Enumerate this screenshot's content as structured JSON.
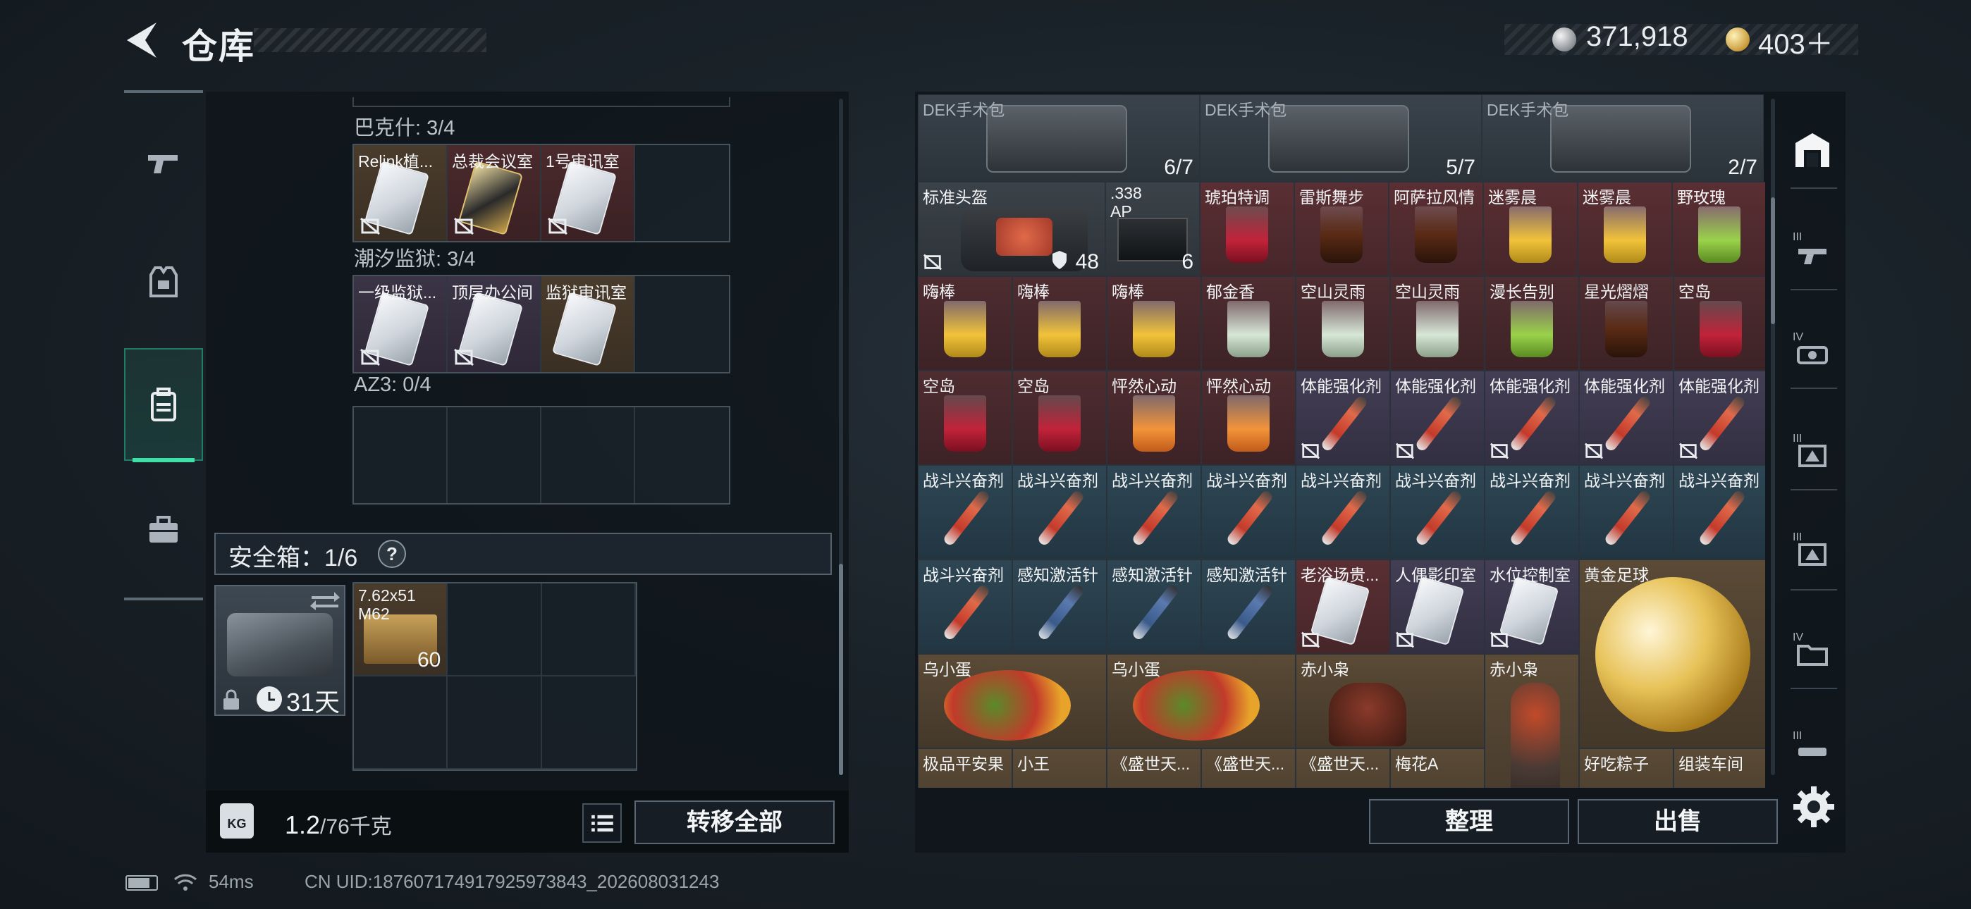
{
  "header": {
    "title": "仓库",
    "silver": "371,918",
    "gold": "403＋"
  },
  "left_groups": [
    {
      "label": "巴克什: 3/4",
      "slots": [
        "Relink植...",
        "总裁会议室",
        "1号审讯室",
        ""
      ]
    },
    {
      "label": "潮汐监狱: 3/4",
      "slots": [
        "一级监狱...",
        "顶层办公间",
        "监狱审讯室",
        ""
      ]
    },
    {
      "label": "AZ3: 0/4",
      "slots": [
        "",
        "",
        "",
        ""
      ]
    }
  ],
  "safe": {
    "label": "安全箱：1/6",
    "help": "?",
    "days": "31天",
    "ammo_name_1": "7.62x51",
    "ammo_name_2": "M62",
    "ammo_count": "60"
  },
  "weight": {
    "icon": "KG",
    "current": "1.2",
    "unit": "/76千克"
  },
  "buttons": {
    "transfer_all": "转移全部",
    "sort": "整理",
    "sell": "出售"
  },
  "inventory": {
    "medkits": [
      {
        "name": "DEK手术包",
        "count": "6/7"
      },
      {
        "name": "DEK手术包",
        "count": "5/7"
      },
      {
        "name": "DEK手术包",
        "count": "2/7"
      }
    ],
    "helmet": {
      "name": "标准头盔",
      "count": "48"
    },
    "ammo338": {
      "name1": ".338",
      "name2": "AP",
      "count": "6"
    },
    "row1_drinks": [
      "琥珀特调",
      "雷斯舞步",
      "阿萨拉风情",
      "迷雾晨",
      "迷雾晨",
      "野玫瑰"
    ],
    "row2": [
      "嗨棒",
      "嗨棒",
      "嗨棒",
      "郁金香",
      "空山灵雨",
      "空山灵雨",
      "漫长告别",
      "星光熠熠",
      "空岛"
    ],
    "row3": [
      "空岛",
      "空岛",
      "怦然心动",
      "怦然心动",
      "体能强化剂",
      "体能强化剂",
      "体能强化剂",
      "体能强化剂",
      "体能强化剂"
    ],
    "row4": [
      "战斗兴奋剂",
      "战斗兴奋剂",
      "战斗兴奋剂",
      "战斗兴奋剂",
      "战斗兴奋剂",
      "战斗兴奋剂",
      "战斗兴奋剂",
      "战斗兴奋剂",
      "战斗兴奋剂"
    ],
    "row5": [
      "战斗兴奋剂",
      "感知激活针",
      "感知激活针",
      "感知激活针",
      "老浴场贵...",
      "人偶影印室",
      "水位控制室"
    ],
    "gold_ball": "黄金足球",
    "figures": [
      "乌小蛋",
      "乌小蛋",
      "赤小枭",
      "赤小枭"
    ],
    "row7": [
      "极品平安果",
      "小王",
      "《盛世天...",
      "《盛世天...",
      "《盛世天...",
      "梅花A",
      "",
      "好吃粽子",
      "组装车间"
    ]
  },
  "footer": {
    "ping": "54ms",
    "uid": "CN UID:187607174917925973843_202608031243"
  },
  "colors": {
    "accent_green": "#3ee0a7",
    "panel_bg": "#0e141a"
  },
  "icons": {
    "nav": [
      "pistol-icon",
      "armor-vest-icon",
      "backpack-icon",
      "toolbox-icon"
    ],
    "right_nav": [
      "warehouse-icon",
      "tier3-weapon-icon",
      "tier4-optic-icon",
      "tier3-ammo-icon",
      "tier3-gear-icon",
      "tier4-folder-icon",
      "tier3-misc-icon"
    ]
  }
}
